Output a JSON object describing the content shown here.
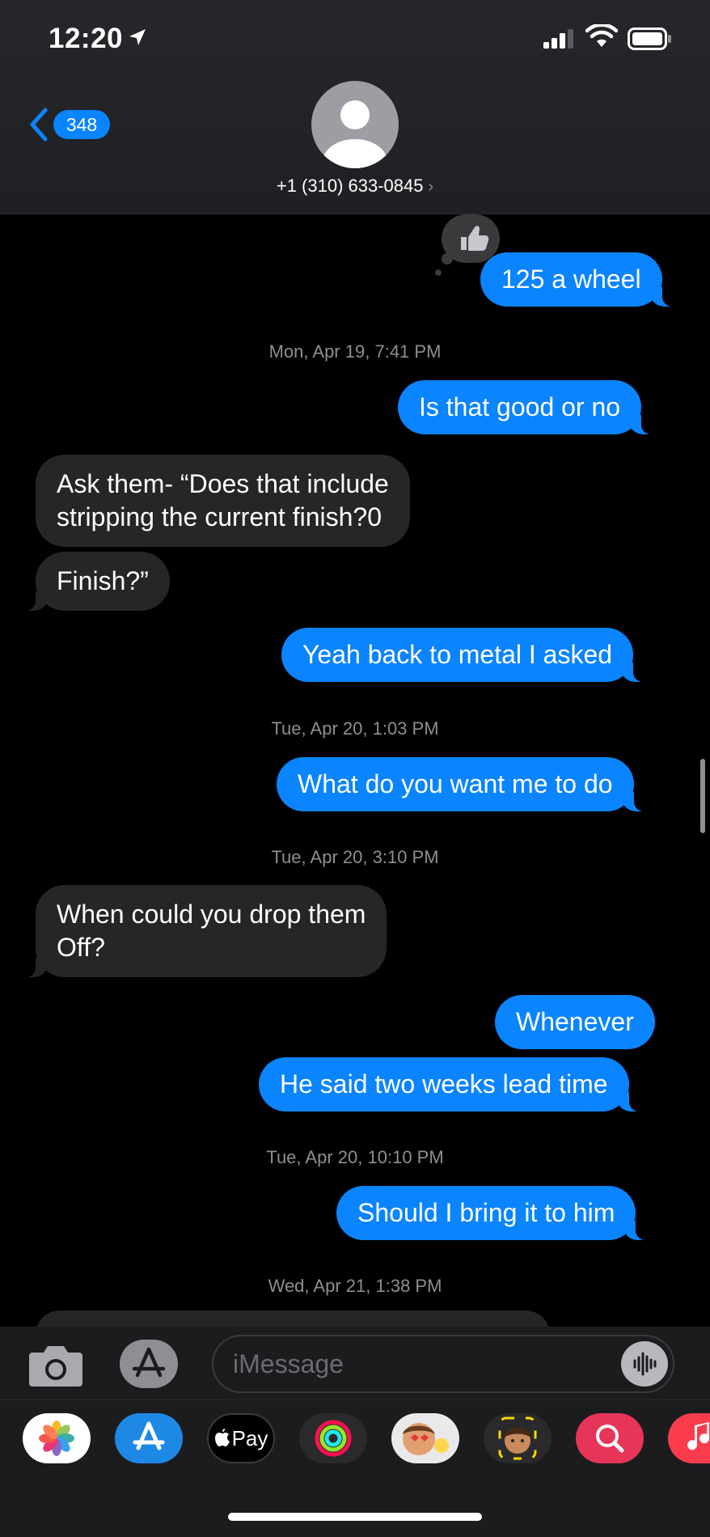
{
  "status_bar": {
    "time": "12:20"
  },
  "nav": {
    "back_count": "348",
    "contact": "+1 (310) 633-0845",
    "contact_chevron": "›"
  },
  "messages": [
    {
      "type": "out",
      "text": "125 a wheel",
      "tapback": "thumbs-up"
    },
    {
      "type": "timestamp",
      "day": "Mon, Apr 19,",
      "time": "7:41 PM"
    },
    {
      "type": "out",
      "text": "Is that good or no"
    },
    {
      "type": "in",
      "text": "Ask them- “Does that include\nstripping the current finish?0"
    },
    {
      "type": "in",
      "text": "Finish?”"
    },
    {
      "type": "out",
      "text": "Yeah back to metal I asked"
    },
    {
      "type": "timestamp",
      "day": "Tue, Apr 20,",
      "time": "1:03 PM"
    },
    {
      "type": "out",
      "text": "What do you want me to do"
    },
    {
      "type": "timestamp",
      "day": "Tue, Apr 20,",
      "time": "3:10 PM"
    },
    {
      "type": "in",
      "text": "When could you drop them\nOff?"
    },
    {
      "type": "out",
      "text": "Whenever"
    },
    {
      "type": "out",
      "text": "He said two weeks lead time"
    },
    {
      "type": "timestamp",
      "day": "Tue, Apr 20,",
      "time": "10:10 PM"
    },
    {
      "type": "out",
      "text": "Should I bring it to him"
    },
    {
      "type": "timestamp",
      "day": "Wed, Apr 21,",
      "time": "1:38 PM"
    }
  ],
  "input": {
    "placeholder": "iMessage"
  },
  "app_strip": [
    {
      "name": "photos-icon"
    },
    {
      "name": "app-store-icon"
    },
    {
      "name": "apple-pay-icon",
      "label": "Pay"
    },
    {
      "name": "fitness-icon"
    },
    {
      "name": "memoji-stickers-icon"
    },
    {
      "name": "memoji-icon"
    },
    {
      "name": "images-search-icon"
    },
    {
      "name": "music-icon"
    }
  ],
  "colors": {
    "outgoing_bubble": "#0a84ff",
    "incoming_bubble": "#262628",
    "background": "#000000"
  }
}
